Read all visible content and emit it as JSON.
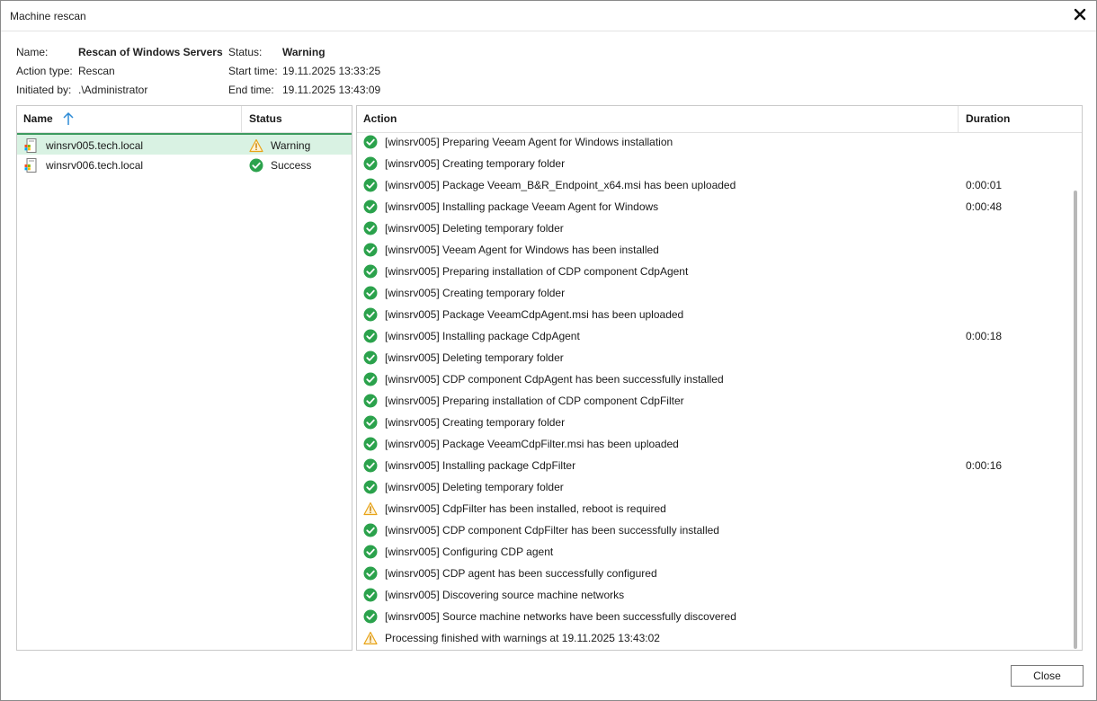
{
  "window": {
    "title": "Machine rescan"
  },
  "info": {
    "name_label": "Name:",
    "name_value": "Rescan of Windows Servers",
    "action_type_label": "Action type:",
    "action_type_value": "Rescan",
    "initiated_by_label": "Initiated by:",
    "initiated_by_value": ".\\Administrator",
    "status_label": "Status:",
    "status_value": "Warning",
    "start_time_label": "Start time:",
    "start_time_value": "19.11.2025 13:33:25",
    "end_time_label": "End time:",
    "end_time_value": "19.11.2025 13:43:09"
  },
  "machines": {
    "headers": {
      "name": "Name",
      "status": "Status"
    },
    "sort": "ascending",
    "rows": [
      {
        "name": "winsrv005.tech.local",
        "status": "Warning",
        "icon": "warning-icon",
        "selected": true
      },
      {
        "name": "winsrv006.tech.local",
        "status": "Success",
        "icon": "success-icon",
        "selected": false
      }
    ]
  },
  "actions": {
    "headers": {
      "action": "Action",
      "duration": "Duration"
    },
    "rows": [
      {
        "icon": "success",
        "text": "[winsrv005] Preparing Veeam Agent for Windows installation",
        "duration": ""
      },
      {
        "icon": "success",
        "text": "[winsrv005] Creating temporary folder",
        "duration": ""
      },
      {
        "icon": "success",
        "text": "[winsrv005] Package Veeam_B&R_Endpoint_x64.msi has been uploaded",
        "duration": "0:00:01"
      },
      {
        "icon": "success",
        "text": "[winsrv005] Installing package Veeam Agent for Windows",
        "duration": "0:00:48"
      },
      {
        "icon": "success",
        "text": "[winsrv005] Deleting temporary folder",
        "duration": ""
      },
      {
        "icon": "success",
        "text": "[winsrv005] Veeam Agent for Windows has been installed",
        "duration": ""
      },
      {
        "icon": "success",
        "text": "[winsrv005] Preparing installation of CDP component CdpAgent",
        "duration": ""
      },
      {
        "icon": "success",
        "text": "[winsrv005] Creating temporary folder",
        "duration": ""
      },
      {
        "icon": "success",
        "text": "[winsrv005] Package VeeamCdpAgent.msi has been uploaded",
        "duration": ""
      },
      {
        "icon": "success",
        "text": "[winsrv005] Installing package CdpAgent",
        "duration": "0:00:18"
      },
      {
        "icon": "success",
        "text": "[winsrv005] Deleting temporary folder",
        "duration": ""
      },
      {
        "icon": "success",
        "text": "[winsrv005] CDP component CdpAgent has been successfully installed",
        "duration": ""
      },
      {
        "icon": "success",
        "text": "[winsrv005] Preparing installation of CDP component CdpFilter",
        "duration": ""
      },
      {
        "icon": "success",
        "text": "[winsrv005] Creating temporary folder",
        "duration": ""
      },
      {
        "icon": "success",
        "text": "[winsrv005] Package VeeamCdpFilter.msi has been uploaded",
        "duration": ""
      },
      {
        "icon": "success",
        "text": "[winsrv005] Installing package CdpFilter",
        "duration": "0:00:16"
      },
      {
        "icon": "success",
        "text": "[winsrv005] Deleting temporary folder",
        "duration": ""
      },
      {
        "icon": "warning",
        "text": "[winsrv005] CdpFilter has been installed, reboot is required",
        "duration": ""
      },
      {
        "icon": "success",
        "text": "[winsrv005] CDP component CdpFilter has been successfully installed",
        "duration": ""
      },
      {
        "icon": "success",
        "text": "[winsrv005] Configuring CDP agent",
        "duration": ""
      },
      {
        "icon": "success",
        "text": "[winsrv005] CDP agent has been successfully configured",
        "duration": ""
      },
      {
        "icon": "success",
        "text": "[winsrv005] Discovering source machine networks",
        "duration": ""
      },
      {
        "icon": "success",
        "text": "[winsrv005] Source machine networks have been successfully discovered",
        "duration": ""
      },
      {
        "icon": "warning",
        "text": "Processing finished with warnings at 19.11.2025 13:43:02",
        "duration": ""
      }
    ]
  },
  "footer": {
    "close_label": "Close"
  },
  "colors": {
    "success": "#2ba24c",
    "warning": "#e8a317",
    "selected_row": "#d9f2e3",
    "sort_arrow": "#2e8bd6"
  }
}
